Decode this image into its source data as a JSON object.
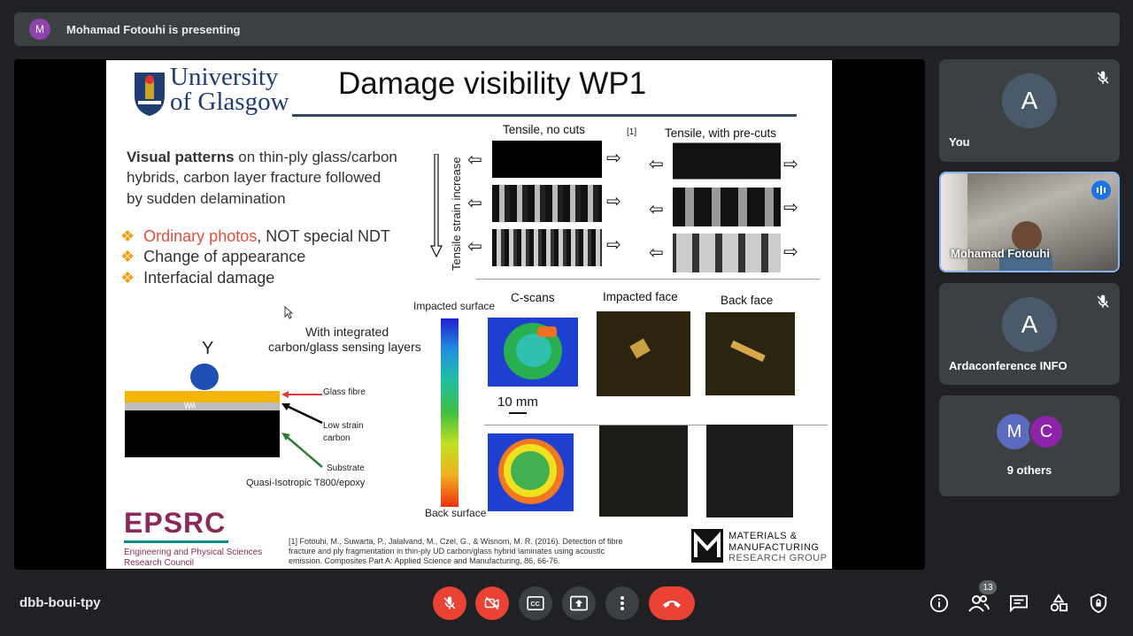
{
  "presenting": {
    "avatar_letter": "M",
    "text": "Mohamad Fotouhi is presenting"
  },
  "slide": {
    "uni_line1": "University",
    "uni_line2": "of Glasgow",
    "title": "Damage visibility WP1",
    "intro_bold": "Visual patterns",
    "intro_rest1": " on thin-ply glass/carbon",
    "intro_line2": "hybrids, carbon layer fracture followed",
    "intro_line3": "by sudden delamination",
    "bullet1_red": "Ordinary photos",
    "bullet1_rest": ", NOT special NDT",
    "bullet2": "Change of appearance",
    "bullet3": "Interfacial damage",
    "strain_label": "Tensile  strain increase",
    "tensile_no_cuts": "Tensile, no cuts",
    "ref_tag": "[1]",
    "tensile_precuts": "Tensile, with pre-cuts",
    "integrated_line1": "With integrated",
    "integrated_line2": "carbon/glass sensing layers",
    "impacted_surface": "Impacted surface",
    "back_surface": "Back surface",
    "cscans": "C-scans",
    "impacted_face": "Impacted face",
    "back_face": "Back face",
    "scale_label": "10 mm",
    "glass_fibre": "Glass fibre",
    "low_strain_1": "Low strain",
    "low_strain_2": "carbon",
    "substrate": "Substrate",
    "quasi": "Quasi-Isotropic T800/epoxy",
    "epsrc": "EPSRC",
    "epsrc_sub1": "Engineering and Physical Sciences",
    "epsrc_sub2": "Research Council",
    "ref_line1": "[1] Fotouhi, M., Suwarta, P., Jalalvand, M., Czel, G., & Wisnom, M. R. (2016). Detection of fibre",
    "ref_line2": "fracture and ply fragmentation in thin-ply UD carbon/glass hybrid laminates using acoustic",
    "ref_line3": "emission. Composites Part A: Applied Science and Manufacturing, 86, 66-76.",
    "mmrg1": "MATERIALS &",
    "mmrg2": "MANUFACTURING",
    "mmrg3": "RESEARCH GROUP"
  },
  "participants": [
    {
      "letter": "A",
      "name": "You",
      "muted": true
    },
    {
      "name": "Mohamad Fotouhi",
      "speaking": true
    },
    {
      "letter": "A",
      "name": "Ardaconference INFO",
      "muted": true
    },
    {
      "letters": [
        "M",
        "C"
      ],
      "name": "9 others"
    }
  ],
  "meeting_code": "dbb-boui-tpy",
  "people_count": "13",
  "colors": {
    "red": "#ea4335",
    "accent": "#8ab4f8",
    "bg": "#202124",
    "tile": "#3c4043"
  }
}
